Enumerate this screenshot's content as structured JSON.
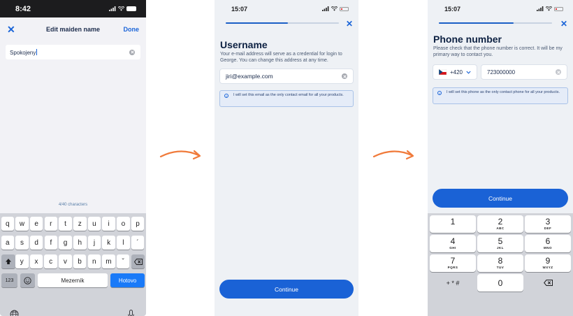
{
  "screen1": {
    "status_time": "8:42",
    "nav_title": "Edit maiden name",
    "nav_done": "Done",
    "field_value": "Spokojeny",
    "char_counter": "4/40 characters",
    "keyboard": {
      "row1": [
        "q",
        "w",
        "e",
        "r",
        "t",
        "z",
        "u",
        "i",
        "o",
        "p"
      ],
      "row2": [
        "a",
        "s",
        "d",
        "f",
        "g",
        "h",
        "j",
        "k",
        "l",
        "´"
      ],
      "row3": [
        "y",
        "x",
        "c",
        "v",
        "b",
        "n",
        "m",
        "ˇ"
      ],
      "num_label": "123",
      "space_label": "Mezerník",
      "return_label": "Hotovo"
    }
  },
  "screen2": {
    "status_time": "15:07",
    "heading": "Username",
    "description": "Your e-mail address will serve as a credential for login to George. You can change this address at any time.",
    "email_value": "jiri@example.com",
    "info_text": "I will set this email as the only contact email for all your products.",
    "continue_label": "Continue",
    "progress": 0.55
  },
  "screen3": {
    "status_time": "15:07",
    "heading": "Phone number",
    "description": "Please check that the phone number is correct. It will be my primary way to contact you.",
    "country_code": "+420",
    "phone_value": "723000000",
    "info_text": "I will set this phone as the only contact phone for all your products.",
    "continue_label": "Continue",
    "progress": 0.66,
    "numpad": [
      {
        "d": "1",
        "l": ""
      },
      {
        "d": "2",
        "l": "ABC"
      },
      {
        "d": "3",
        "l": "DEF"
      },
      {
        "d": "4",
        "l": "GHI"
      },
      {
        "d": "5",
        "l": "JKL"
      },
      {
        "d": "6",
        "l": "MNO"
      },
      {
        "d": "7",
        "l": "PQRS"
      },
      {
        "d": "8",
        "l": "TUV"
      },
      {
        "d": "9",
        "l": "WXYZ"
      }
    ],
    "numpad_symbols": "+ * #",
    "numpad_zero": "0"
  },
  "colors": {
    "accent": "#1a62d6",
    "arrow": "#f07a3a",
    "heading": "#0d2142"
  }
}
